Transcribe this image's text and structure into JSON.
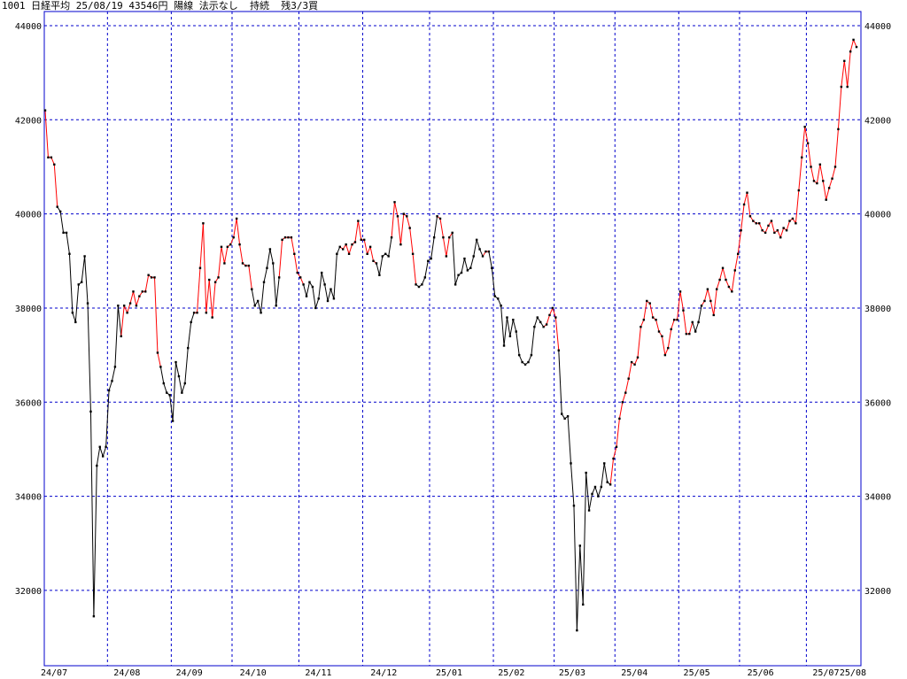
{
  "header": {
    "code": "1001",
    "name": "日経平均",
    "date": "25/08/19",
    "price": "43546円",
    "candle": "陽線",
    "signal": "法示なし",
    "trend": "持続",
    "remaining": "残3/3買"
  },
  "colors": {
    "up": "#ff0000",
    "down": "#000000",
    "grid": "#0000cc",
    "frame": "#0000cc"
  },
  "chart_data": {
    "type": "line",
    "ylim": [
      30400,
      44300
    ],
    "yticks": [
      32000,
      34000,
      36000,
      38000,
      40000,
      42000,
      44000
    ],
    "ytick_labels": [
      "32000",
      "34000",
      "36000",
      "38000",
      "40000",
      "42000",
      "44000"
    ],
    "xtick_labels": [
      "24/07",
      "24/08",
      "24/09",
      "24/10",
      "24/11",
      "24/12",
      "25/01",
      "25/02",
      "25/03",
      "25/04",
      "25/05",
      "25/06",
      "25/07",
      "25/08"
    ],
    "month_start_index": [
      0,
      21,
      42,
      62,
      84,
      105,
      127,
      148,
      168,
      188,
      209,
      229,
      251,
      272
    ],
    "grid": true,
    "colored_by_trend": true,
    "values": [
      42200,
      41200,
      41200,
      41050,
      40150,
      40050,
      39600,
      39600,
      39150,
      37900,
      37700,
      38500,
      38550,
      39100,
      38100,
      35800,
      31450,
      34650,
      35050,
      34850,
      35050,
      36250,
      36450,
      36750,
      38050,
      37400,
      38050,
      37900,
      38100,
      38350,
      38050,
      38250,
      38350,
      38350,
      38700,
      38650,
      38650,
      37050,
      36750,
      36400,
      36200,
      36150,
      35600,
      36850,
      36550,
      36200,
      36400,
      37150,
      37700,
      37900,
      37900,
      38850,
      39800,
      37900,
      38600,
      37800,
      38550,
      38650,
      39300,
      38950,
      39300,
      39350,
      39500,
      39900,
      39350,
      38950,
      38900,
      38900,
      38400,
      38050,
      38150,
      37900,
      38550,
      38850,
      39250,
      38950,
      38050,
      38650,
      39450,
      39500,
      39500,
      39500,
      39150,
      38750,
      38650,
      38500,
      38250,
      38550,
      38450,
      38000,
      38200,
      38750,
      38500,
      38150,
      38400,
      38200,
      39150,
      39300,
      39250,
      39350,
      39150,
      39350,
      39400,
      39850,
      39450,
      39450,
      39150,
      39300,
      39000,
      38950,
      38700,
      39100,
      39150,
      39100,
      39500,
      40250,
      39950,
      39350,
      40000,
      39950,
      39700,
      39150,
      38500,
      38450,
      38500,
      38650,
      39000,
      39050,
      39500,
      39950,
      39900,
      39500,
      39100,
      39500,
      39600,
      38500,
      38700,
      38750,
      39050,
      38800,
      38850,
      39100,
      39450,
      39250,
      39100,
      39200,
      39200,
      38850,
      38250,
      38200,
      38050,
      37200,
      37800,
      37400,
      37750,
      37500,
      37000,
      36850,
      36800,
      36850,
      37000,
      37600,
      37800,
      37700,
      37600,
      37650,
      37850,
      38000,
      37800,
      37100,
      35750,
      35650,
      35700,
      34700,
      33800,
      31150,
      32950,
      31700,
      34500,
      33700,
      34050,
      34200,
      34000,
      34200,
      34700,
      34300,
      34250,
      34800,
      35050,
      35650,
      36000,
      36200,
      36500,
      36850,
      36800,
      36950,
      37600,
      37750,
      38150,
      38100,
      37800,
      37750,
      37500,
      37400,
      37000,
      37150,
      37550,
      37750,
      37750,
      38350,
      37950,
      37450,
      37450,
      37700,
      37500,
      37700,
      38050,
      38150,
      38400,
      38150,
      37850,
      38400,
      38600,
      38850,
      38600,
      38450,
      38350,
      38800,
      39150,
      39650,
      40200,
      40450,
      39950,
      39850,
      39800,
      39800,
      39650,
      39600,
      39750,
      39850,
      39600,
      39650,
      39500,
      39700,
      39650,
      39850,
      39900,
      39800,
      40500,
      41200,
      41850,
      41500,
      41000,
      40700,
      40650,
      41050,
      40700,
      40300,
      40550,
      40750,
      41000,
      41800,
      42700,
      43250,
      42700,
      43450,
      43700,
      43546
    ]
  }
}
